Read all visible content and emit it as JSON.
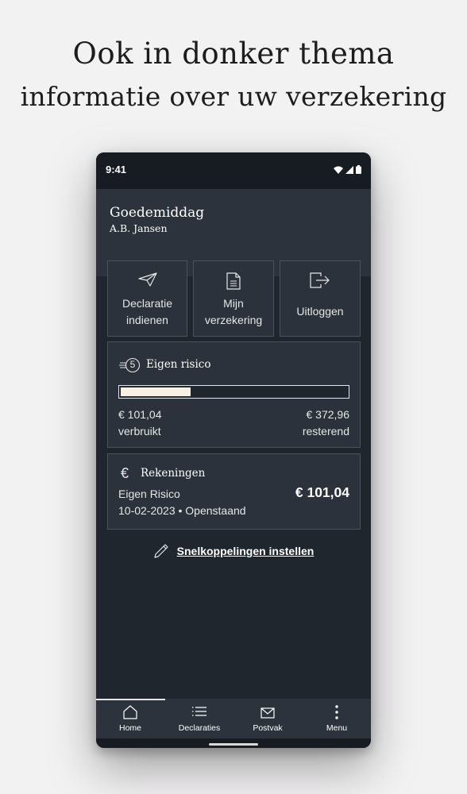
{
  "promo": {
    "line1": "Ook in donker thema",
    "line2": "informatie over uw verzekering"
  },
  "statusbar": {
    "time": "9:41",
    "icons": [
      "wifi-icon",
      "cellular-signal-icon",
      "battery-icon"
    ]
  },
  "header": {
    "greeting": "Goedemiddag",
    "user": "A.B. Jansen"
  },
  "tiles": [
    {
      "label1": "Declaratie",
      "label2": "indienen",
      "icon": "paper-plane-icon"
    },
    {
      "label1": "Mijn",
      "label2": "verzekering",
      "icon": "document-icon"
    },
    {
      "label1": "Uitloggen",
      "icon": "logout-icon"
    }
  ],
  "eigen_risico": {
    "title": "Eigen risico",
    "icon_number": "5",
    "used_amount": "€ 101,04",
    "used_label": "verbruikt",
    "remaining_amount": "€ 372,96",
    "remaining_label": "resterend",
    "progress_fraction": 0.32
  },
  "rekeningen": {
    "icon": "€",
    "title": "Rekeningen",
    "item_title": "Eigen Risico",
    "item_meta": "10-02-2023 • Openstaand",
    "amount": "€ 101,04"
  },
  "shortcut": {
    "label": "Snelkoppelingen instellen"
  },
  "nav": [
    {
      "label": "Home",
      "icon": "home-icon",
      "active": true
    },
    {
      "label": "Declaraties",
      "icon": "list-icon"
    },
    {
      "label": "Postvak",
      "icon": "envelope-icon"
    },
    {
      "label": "Menu",
      "icon": "more-vertical-icon"
    }
  ],
  "colors": {
    "page_bg": "#f3f2f3",
    "phone_bg": "#1f262e",
    "card_bg": "#2b323b",
    "card_border": "#4a525c",
    "progress_fill": "#f6f1e2"
  }
}
